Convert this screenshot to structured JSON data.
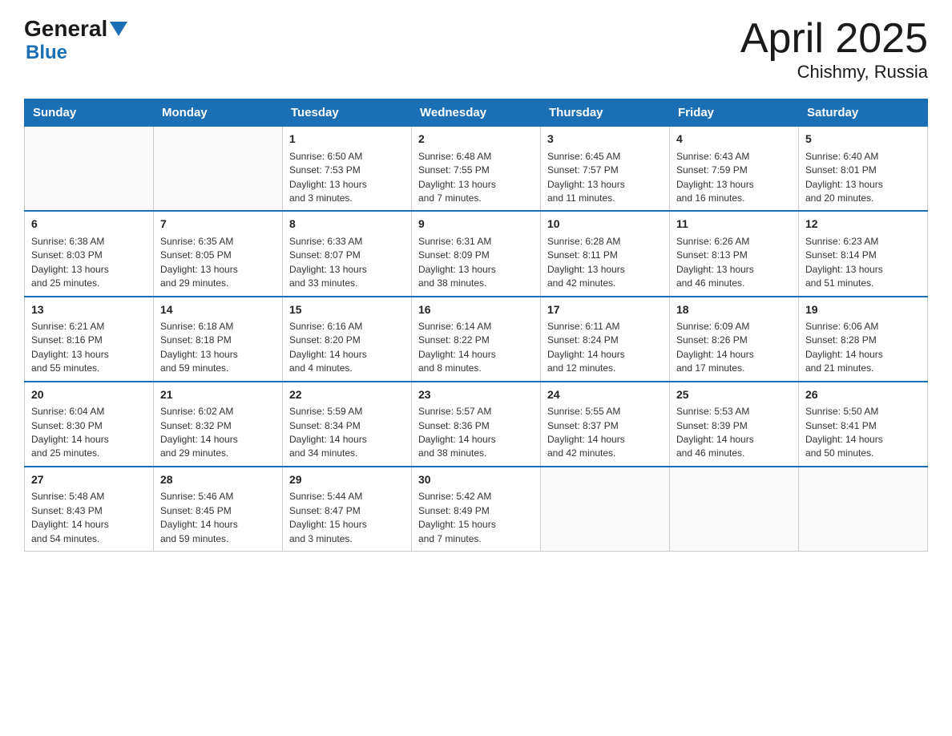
{
  "logo": {
    "general": "General",
    "arrow": "▼",
    "blue": "Blue"
  },
  "title": "April 2025",
  "subtitle": "Chishmy, Russia",
  "days_of_week": [
    "Sunday",
    "Monday",
    "Tuesday",
    "Wednesday",
    "Thursday",
    "Friday",
    "Saturday"
  ],
  "weeks": [
    [
      {
        "day": "",
        "info": ""
      },
      {
        "day": "",
        "info": ""
      },
      {
        "day": "1",
        "info": "Sunrise: 6:50 AM\nSunset: 7:53 PM\nDaylight: 13 hours\nand 3 minutes."
      },
      {
        "day": "2",
        "info": "Sunrise: 6:48 AM\nSunset: 7:55 PM\nDaylight: 13 hours\nand 7 minutes."
      },
      {
        "day": "3",
        "info": "Sunrise: 6:45 AM\nSunset: 7:57 PM\nDaylight: 13 hours\nand 11 minutes."
      },
      {
        "day": "4",
        "info": "Sunrise: 6:43 AM\nSunset: 7:59 PM\nDaylight: 13 hours\nand 16 minutes."
      },
      {
        "day": "5",
        "info": "Sunrise: 6:40 AM\nSunset: 8:01 PM\nDaylight: 13 hours\nand 20 minutes."
      }
    ],
    [
      {
        "day": "6",
        "info": "Sunrise: 6:38 AM\nSunset: 8:03 PM\nDaylight: 13 hours\nand 25 minutes."
      },
      {
        "day": "7",
        "info": "Sunrise: 6:35 AM\nSunset: 8:05 PM\nDaylight: 13 hours\nand 29 minutes."
      },
      {
        "day": "8",
        "info": "Sunrise: 6:33 AM\nSunset: 8:07 PM\nDaylight: 13 hours\nand 33 minutes."
      },
      {
        "day": "9",
        "info": "Sunrise: 6:31 AM\nSunset: 8:09 PM\nDaylight: 13 hours\nand 38 minutes."
      },
      {
        "day": "10",
        "info": "Sunrise: 6:28 AM\nSunset: 8:11 PM\nDaylight: 13 hours\nand 42 minutes."
      },
      {
        "day": "11",
        "info": "Sunrise: 6:26 AM\nSunset: 8:13 PM\nDaylight: 13 hours\nand 46 minutes."
      },
      {
        "day": "12",
        "info": "Sunrise: 6:23 AM\nSunset: 8:14 PM\nDaylight: 13 hours\nand 51 minutes."
      }
    ],
    [
      {
        "day": "13",
        "info": "Sunrise: 6:21 AM\nSunset: 8:16 PM\nDaylight: 13 hours\nand 55 minutes."
      },
      {
        "day": "14",
        "info": "Sunrise: 6:18 AM\nSunset: 8:18 PM\nDaylight: 13 hours\nand 59 minutes."
      },
      {
        "day": "15",
        "info": "Sunrise: 6:16 AM\nSunset: 8:20 PM\nDaylight: 14 hours\nand 4 minutes."
      },
      {
        "day": "16",
        "info": "Sunrise: 6:14 AM\nSunset: 8:22 PM\nDaylight: 14 hours\nand 8 minutes."
      },
      {
        "day": "17",
        "info": "Sunrise: 6:11 AM\nSunset: 8:24 PM\nDaylight: 14 hours\nand 12 minutes."
      },
      {
        "day": "18",
        "info": "Sunrise: 6:09 AM\nSunset: 8:26 PM\nDaylight: 14 hours\nand 17 minutes."
      },
      {
        "day": "19",
        "info": "Sunrise: 6:06 AM\nSunset: 8:28 PM\nDaylight: 14 hours\nand 21 minutes."
      }
    ],
    [
      {
        "day": "20",
        "info": "Sunrise: 6:04 AM\nSunset: 8:30 PM\nDaylight: 14 hours\nand 25 minutes."
      },
      {
        "day": "21",
        "info": "Sunrise: 6:02 AM\nSunset: 8:32 PM\nDaylight: 14 hours\nand 29 minutes."
      },
      {
        "day": "22",
        "info": "Sunrise: 5:59 AM\nSunset: 8:34 PM\nDaylight: 14 hours\nand 34 minutes."
      },
      {
        "day": "23",
        "info": "Sunrise: 5:57 AM\nSunset: 8:36 PM\nDaylight: 14 hours\nand 38 minutes."
      },
      {
        "day": "24",
        "info": "Sunrise: 5:55 AM\nSunset: 8:37 PM\nDaylight: 14 hours\nand 42 minutes."
      },
      {
        "day": "25",
        "info": "Sunrise: 5:53 AM\nSunset: 8:39 PM\nDaylight: 14 hours\nand 46 minutes."
      },
      {
        "day": "26",
        "info": "Sunrise: 5:50 AM\nSunset: 8:41 PM\nDaylight: 14 hours\nand 50 minutes."
      }
    ],
    [
      {
        "day": "27",
        "info": "Sunrise: 5:48 AM\nSunset: 8:43 PM\nDaylight: 14 hours\nand 54 minutes."
      },
      {
        "day": "28",
        "info": "Sunrise: 5:46 AM\nSunset: 8:45 PM\nDaylight: 14 hours\nand 59 minutes."
      },
      {
        "day": "29",
        "info": "Sunrise: 5:44 AM\nSunset: 8:47 PM\nDaylight: 15 hours\nand 3 minutes."
      },
      {
        "day": "30",
        "info": "Sunrise: 5:42 AM\nSunset: 8:49 PM\nDaylight: 15 hours\nand 7 minutes."
      },
      {
        "day": "",
        "info": ""
      },
      {
        "day": "",
        "info": ""
      },
      {
        "day": "",
        "info": ""
      }
    ]
  ]
}
